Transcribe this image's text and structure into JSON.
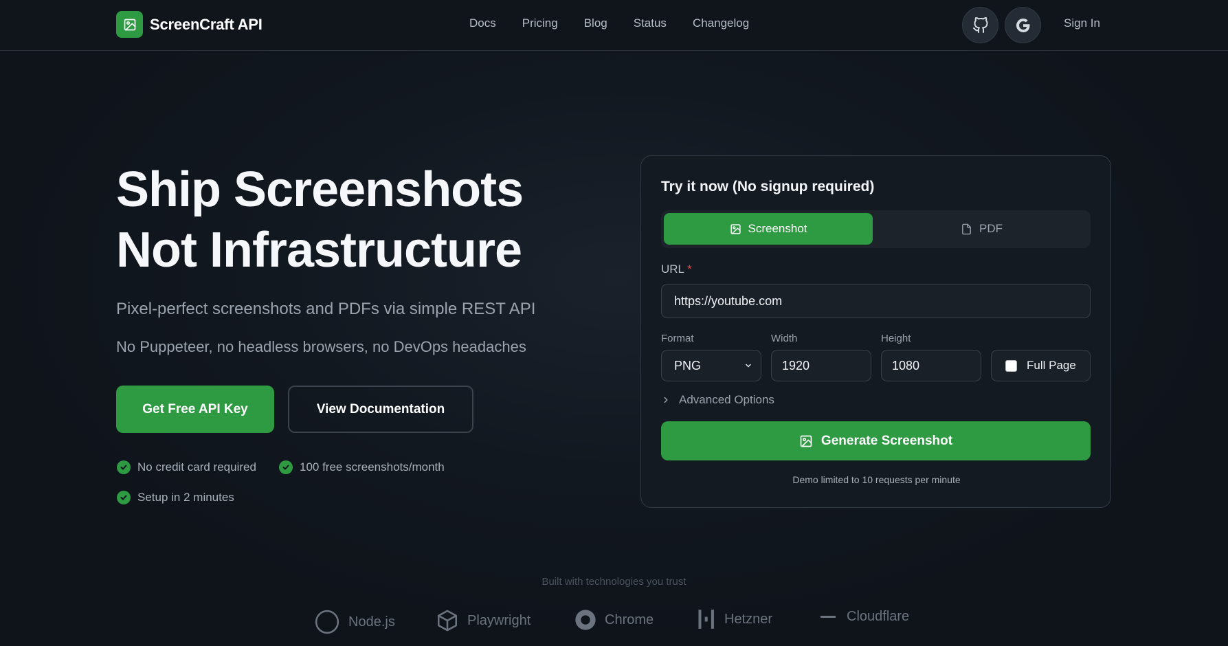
{
  "brand": {
    "name": "ScreenCraft API",
    "icon": "image-icon",
    "accent": "#2e9a42"
  },
  "nav": {
    "links": [
      "Docs",
      "Pricing",
      "Blog",
      "Status",
      "Changelog"
    ],
    "github_icon": "github-icon",
    "google_icon": "google-icon",
    "signin": "Sign In"
  },
  "hero": {
    "title_line1": "Ship Screenshots",
    "title_line2": "Not Infrastructure",
    "subtitle1": "Pixel-perfect screenshots and PDFs via simple REST API",
    "subtitle2": "No Puppeteer, no headless browsers, no DevOps headaches",
    "cta_primary": "Get Free API Key",
    "cta_secondary": "View Documentation",
    "checks": [
      "No credit card required",
      "100 free screenshots/month",
      "Setup in 2 minutes"
    ]
  },
  "card": {
    "title": "Try it now (No signup required)",
    "tabs": [
      {
        "label": "Screenshot",
        "icon": "image-icon",
        "active": true
      },
      {
        "label": "PDF",
        "icon": "file-icon",
        "active": false
      }
    ],
    "url_label": "URL",
    "url_required": "*",
    "url_value": "https://youtube.com",
    "format_label": "Format",
    "format_value": "PNG",
    "width_label": "Width",
    "width_value": "1920",
    "height_label": "Height",
    "height_value": "1080",
    "fullpage_label": "Full Page",
    "fullpage_checked": false,
    "advanced_label": "Advanced Options",
    "generate_label": "Generate Screenshot",
    "demo_note": "Demo limited to 10 requests per minute"
  },
  "tech": {
    "title": "Built with technologies you trust",
    "items": [
      {
        "label": "Node.js",
        "icon": "circle-icon"
      },
      {
        "label": "Playwright",
        "icon": "box-icon"
      },
      {
        "label": "Chrome",
        "icon": "chrome-icon"
      },
      {
        "label": "Hetzner",
        "icon": "bars-icon"
      },
      {
        "label": "Cloudflare",
        "icon": "minus-icon"
      }
    ]
  }
}
